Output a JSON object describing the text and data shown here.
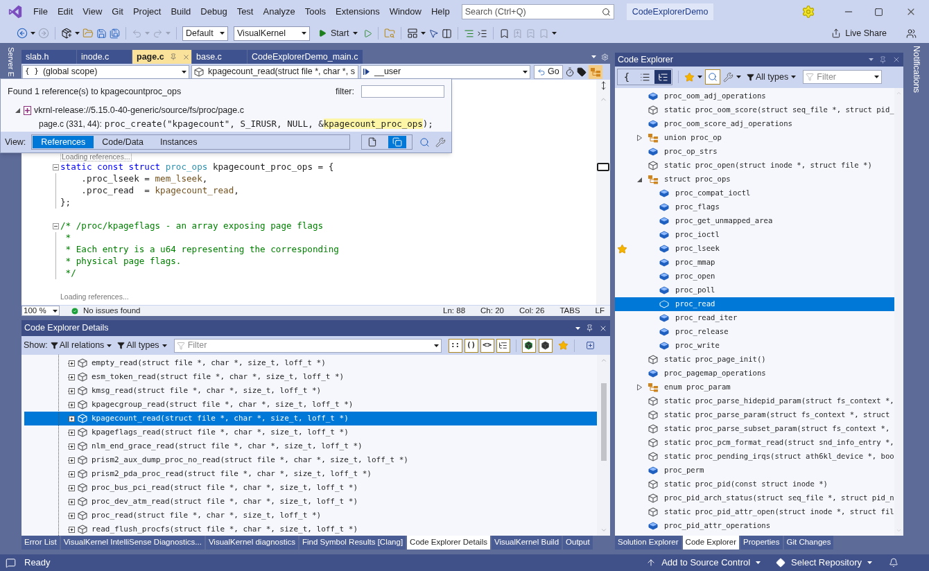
{
  "title_bar": {
    "menu": [
      "File",
      "Edit",
      "View",
      "Git",
      "Project",
      "Build",
      "Debug",
      "Test",
      "Analyze",
      "Tools",
      "Extensions",
      "Window",
      "Help"
    ],
    "search_placeholder": "Search (Ctrl+Q)",
    "solution_name": "CodeExplorerDemo"
  },
  "toolbar": {
    "configuration": "Default",
    "platform": "VisualKernel",
    "start_label": "Start",
    "live_share": "Live Share"
  },
  "side_tabs": {
    "left": "Server E",
    "right": "Notifications"
  },
  "editor": {
    "tabs": [
      {
        "label": "slab.h",
        "selected": false
      },
      {
        "label": "inode.c",
        "selected": false
      },
      {
        "label": "page.c",
        "selected": true
      },
      {
        "label": "base.c",
        "selected": false
      },
      {
        "label": "CodeExplorerDemo_main.c",
        "selected": false
      }
    ],
    "scope_glyph": "{ }",
    "scope": "(global scope)",
    "member": "kpagecount_read(struct file *, char *, s",
    "context": "__user",
    "go_label": "Go",
    "lines": [
      {
        "kind": "hint",
        "text": "Loading references..."
      },
      {
        "kind": "code",
        "collapsible": true,
        "guide": false,
        "tokens": [
          {
            "kind": "keyword",
            "text": "static const struct "
          },
          {
            "kind": "type",
            "text": "proc_ops"
          },
          {
            "kind": "plain",
            "text": " kpagecount_proc_ops = {"
          }
        ]
      },
      {
        "kind": "code",
        "collapsible": false,
        "guide": true,
        "tokens": [
          {
            "kind": "plain",
            "text": "    .proc_lseek = "
          },
          {
            "kind": "func",
            "text": "mem_lseek"
          },
          {
            "kind": "plain",
            "text": ","
          }
        ]
      },
      {
        "kind": "code",
        "collapsible": false,
        "guide": true,
        "tokens": [
          {
            "kind": "plain",
            "text": "    .proc_read  = "
          },
          {
            "kind": "func",
            "text": "kpagecount_read"
          },
          {
            "kind": "plain",
            "text": ","
          }
        ]
      },
      {
        "kind": "code",
        "collapsible": false,
        "guide": true,
        "tokens": [
          {
            "kind": "plain",
            "text": "};"
          }
        ]
      },
      {
        "kind": "blank"
      },
      {
        "kind": "code",
        "collapsible": true,
        "guide": false,
        "tokens": [
          {
            "kind": "comment",
            "text": "/* /proc/kpageflags - an array exposing page flags"
          }
        ]
      },
      {
        "kind": "code",
        "collapsible": false,
        "guide": true,
        "tokens": [
          {
            "kind": "comment",
            "text": " *"
          }
        ]
      },
      {
        "kind": "code",
        "collapsible": false,
        "guide": true,
        "tokens": [
          {
            "kind": "comment",
            "text": " * Each entry is a u64 representing the corresponding"
          }
        ]
      },
      {
        "kind": "code",
        "collapsible": false,
        "guide": true,
        "tokens": [
          {
            "kind": "comment",
            "text": " * physical page flags."
          }
        ]
      },
      {
        "kind": "code",
        "collapsible": false,
        "guide": true,
        "tokens": [
          {
            "kind": "comment",
            "text": " */"
          }
        ]
      },
      {
        "kind": "blank"
      },
      {
        "kind": "hint",
        "text": "Loading references..."
      }
    ],
    "status": {
      "zoom": "100 %",
      "issues": "No issues found",
      "line": "Ln: 88",
      "char": "Ch: 20",
      "col": "Col: 26",
      "indent": "TABS",
      "eol": "LF"
    }
  },
  "references_popup": {
    "summary": "Found 1 reference(s) to kpagecountproc_ops",
    "filter_label": "filter:",
    "file": "vkrnl-release://5.15.0-40-generic/source/fs/proc/page.c",
    "location": "page.c (331, 44):",
    "code_before": "proc_create(\"kpagecount\", S_IRUSR, NULL, &",
    "code_match": "kpagecount_proc_ops",
    "code_after": ");",
    "view_label": "View:",
    "views": [
      {
        "label": "References",
        "selected": true
      },
      {
        "label": "Code/Data",
        "selected": false
      },
      {
        "label": "Instances",
        "selected": false
      }
    ]
  },
  "details": {
    "title": "Code Explorer Details",
    "show_label": "Show:",
    "relations": "All relations",
    "types": "All types",
    "filter_placeholder": "Filter",
    "view_buttons": [
      "::",
      "()",
      "<>"
    ],
    "rows": [
      {
        "text": "empty_read(struct file *, char *, size_t, loff_t *)",
        "selected": false
      },
      {
        "text": "esm_token_read(struct file *, char *, size_t, loff_t *)",
        "selected": false
      },
      {
        "text": "kmsg_read(struct file *, char *, size_t, loff_t *)",
        "selected": false
      },
      {
        "text": "kpagecgroup_read(struct file *, char *, size_t, loff_t *)",
        "selected": false
      },
      {
        "text": "kpagecount_read(struct file *, char *, size_t, loff_t *)",
        "selected": true
      },
      {
        "text": "kpageflags_read(struct file *, char *, size_t, loff_t *)",
        "selected": false
      },
      {
        "text": "nlm_end_grace_read(struct file *, char *, size_t, loff_t *)",
        "selected": false
      },
      {
        "text": "prism2_aux_dump_proc_no_read(struct file *, char *, size_t, loff_t *)",
        "selected": false
      },
      {
        "text": "prism2_pda_proc_read(struct file *, char *, size_t, loff_t *)",
        "selected": false
      },
      {
        "text": "proc_bus_pci_read(struct file *, char *, size_t, loff_t *)",
        "selected": false
      },
      {
        "text": "proc_dev_atm_read(struct file *, char *, size_t, loff_t *)",
        "selected": false
      },
      {
        "text": "proc_read(struct file *, char *, size_t, loff_t *)",
        "selected": false
      },
      {
        "text": "read_flush_procfs(struct file *, char *, size_t, loff_t *)",
        "selected": false
      }
    ]
  },
  "bottom_tabs": [
    {
      "label": "Error List",
      "selected": false
    },
    {
      "label": "VisualKernel IntelliSense Diagnostics...",
      "selected": false
    },
    {
      "label": "VisualKernel diagnostics",
      "selected": false
    },
    {
      "label": "Find Symbol Results [Clang]",
      "selected": false
    },
    {
      "label": "Code Explorer Details",
      "selected": true
    },
    {
      "label": "VisualKernel Build",
      "selected": false
    },
    {
      "label": "Output",
      "selected": false
    }
  ],
  "explorer": {
    "title": "Code Explorer",
    "view_modes": [
      {
        "kind": "text",
        "label": "{",
        "selected": false
      },
      {
        "kind": "list",
        "selected": false
      },
      {
        "kind": "tree",
        "selected": true
      }
    ],
    "types": "All types",
    "filter_placeholder": "Filter",
    "items": [
      {
        "kind": "field",
        "text": "proc_oom_adj_operations",
        "selected": false
      },
      {
        "kind": "function",
        "text": "static proc_oom_score(struct seq_file *, struct pid_",
        "selected": false
      },
      {
        "kind": "field",
        "text": "proc_oom_score_adj_operations",
        "selected": false
      },
      {
        "kind": "type",
        "text": "union proc_op",
        "expanded": false,
        "selected": false
      },
      {
        "kind": "field",
        "text": "proc_op_strs",
        "selected": false
      },
      {
        "kind": "function",
        "text": "static proc_open(struct inode *, struct file *)",
        "selected": false
      },
      {
        "kind": "type",
        "text": "struct proc_ops",
        "expanded": true,
        "selected": false,
        "children": [
          {
            "kind": "field",
            "text": "proc_compat_ioctl",
            "selected": false,
            "starred": false
          },
          {
            "kind": "field",
            "text": "proc_flags",
            "selected": false,
            "starred": false
          },
          {
            "kind": "field",
            "text": "proc_get_unmapped_area",
            "selected": false,
            "starred": false
          },
          {
            "kind": "field",
            "text": "proc_ioctl",
            "selected": false,
            "starred": false
          },
          {
            "kind": "field",
            "text": "proc_lseek",
            "selected": false,
            "starred": true
          },
          {
            "kind": "field",
            "text": "proc_mmap",
            "selected": false,
            "starred": false
          },
          {
            "kind": "field",
            "text": "proc_open",
            "selected": false,
            "starred": false
          },
          {
            "kind": "field",
            "text": "proc_poll",
            "selected": false,
            "starred": false
          },
          {
            "kind": "field",
            "text": "proc_read",
            "selected": true,
            "starred": false
          },
          {
            "kind": "field",
            "text": "proc_read_iter",
            "selected": false,
            "starred": false
          },
          {
            "kind": "field",
            "text": "proc_release",
            "selected": false,
            "starred": false
          },
          {
            "kind": "field",
            "text": "proc_write",
            "selected": false,
            "starred": false
          }
        ]
      },
      {
        "kind": "function",
        "text": "static proc_page_init()",
        "selected": false
      },
      {
        "kind": "field",
        "text": "proc_pagemap_operations",
        "selected": false
      },
      {
        "kind": "type",
        "text": "enum proc_param",
        "expanded": false,
        "selected": false
      },
      {
        "kind": "function",
        "text": "static proc_parse_hidepid_param(struct fs_context *,",
        "selected": false
      },
      {
        "kind": "function",
        "text": "static proc_parse_param(struct fs_context *, struct",
        "selected": false
      },
      {
        "kind": "function",
        "text": "static proc_parse_subset_param(struct fs_context *,",
        "selected": false
      },
      {
        "kind": "function",
        "text": "static proc_pcm_format_read(struct snd_info_entry *,",
        "selected": false
      },
      {
        "kind": "function",
        "text": "static proc_pending_irqs(struct ath6kl_device *, boo",
        "selected": false
      },
      {
        "kind": "field",
        "text": "proc_perm",
        "selected": false
      },
      {
        "kind": "function",
        "text": "static proc_pid(const struct inode *)",
        "selected": false
      },
      {
        "kind": "function",
        "text": "proc_pid_arch_status(struct seq_file *, struct pid_n",
        "selected": false
      },
      {
        "kind": "function",
        "text": "static proc_pid_attr_open(struct inode *, struct fil",
        "selected": false
      },
      {
        "kind": "field",
        "text": "proc_pid_attr_operations",
        "selected": false
      }
    ]
  },
  "explorer_tabs": [
    {
      "label": "Solution Explorer",
      "selected": false
    },
    {
      "label": "Code Explorer",
      "selected": true
    },
    {
      "label": "Properties",
      "selected": false
    },
    {
      "label": "Git Changes",
      "selected": false
    }
  ],
  "status_bar": {
    "message": "Ready",
    "source_control": "Add to Source Control",
    "repository": "Select Repository"
  }
}
